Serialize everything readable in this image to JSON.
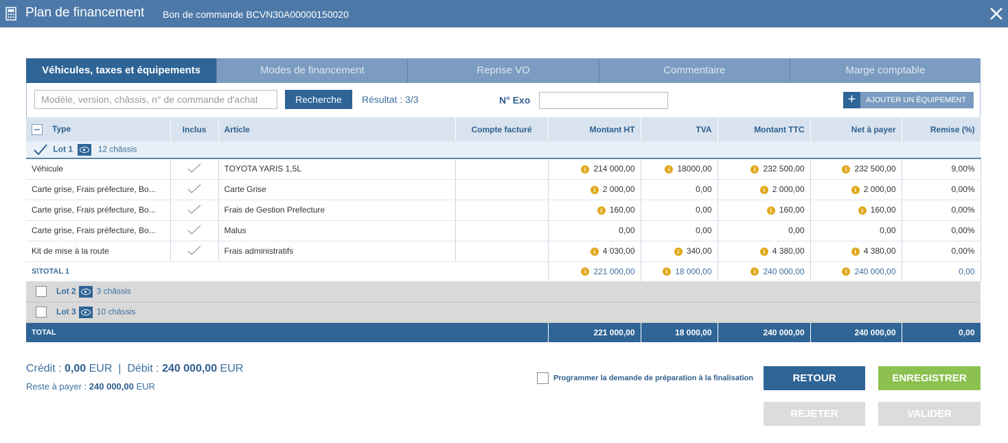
{
  "window": {
    "title": "Plan de financement",
    "subtitle": "Bon de commande BCVN30A00000150020"
  },
  "tabs": [
    {
      "label": "Véhicules, taxes et équipements",
      "active": true
    },
    {
      "label": "Modes de financement",
      "active": false
    },
    {
      "label": "Reprise VO",
      "active": false
    },
    {
      "label": "Commentaire",
      "active": false
    },
    {
      "label": "Marge comptable",
      "active": false
    }
  ],
  "toolbar": {
    "search_placeholder": "Modèle, version, châssis, n° de commande d'achat",
    "search_button": "Recherche",
    "result": "Résultat : 3/3",
    "exo_label": "N° Exo",
    "exo_value": "",
    "add_button": "AJOUTER UN ÉQUIPEMENT"
  },
  "columns": [
    "Type",
    "Inclus",
    "Article",
    "Compte facturé",
    "Montant HT",
    "TVA",
    "Montant TTC",
    "Net à payer",
    "Remise (%)"
  ],
  "lot1": {
    "label": "Lot 1",
    "chassis": "12 châssis"
  },
  "rows": [
    {
      "type": "Véhicule",
      "article": "TOYOTA YARIS 1,5L",
      "compte": "",
      "ht": "214 000,00",
      "tva": "18000,00",
      "ttc": "232 500,00",
      "net": "232 500,00",
      "remise": "9,00%"
    },
    {
      "type": "Carte grise, Frais préfecture, Bo...",
      "article": "Carte Grise",
      "compte": "",
      "ht": "2 000,00",
      "tva": "0,00",
      "ttc": "2 000,00",
      "net": "2 000,00",
      "remise": "0,00%"
    },
    {
      "type": "Carte grise, Frais préfecture, Bo...",
      "article": "Frais de Gestion Prefecture",
      "compte": "",
      "ht": "160,00",
      "tva": "0,00",
      "ttc": "160,00",
      "net": "160,00",
      "remise": "0,00%"
    },
    {
      "type": "Carte grise, Frais préfecture, Bo...",
      "article": "Malus",
      "compte": "",
      "ht": "0,00",
      "tva": "0,00",
      "ttc": "0,00",
      "net": "0,00",
      "remise": "0,00%"
    },
    {
      "type": "Kit de mise à la route",
      "article": "Frais administratifs",
      "compte": "",
      "ht": "4 030,00",
      "tva": "340,00",
      "ttc": "4 380,00",
      "net": "4 380,00",
      "remise": "0,00%"
    }
  ],
  "subtotal": {
    "label": "S\\TOTAL 1",
    "ht": "221 000,00",
    "tva": "18 000,00",
    "ttc": "240 000,00",
    "net": "240 000,00",
    "remise": "0,00"
  },
  "lot2": {
    "label": "Lot 2",
    "chassis": "3 châssis"
  },
  "lot3": {
    "label": "Lot 3",
    "chassis": "10 châssis"
  },
  "total": {
    "label": "TOTAL",
    "ht": "221 000,00",
    "tva": "18 000,00",
    "ttc": "240 000,00",
    "net": "240 000,00",
    "remise": "0,00"
  },
  "footer": {
    "credit_label": "Crédit : ",
    "credit_value": "0,00",
    "currency": "EUR",
    "separator": "|",
    "debit_label": "Débit : ",
    "debit_value": "240 000,00",
    "reste_label": "Reste à payer : ",
    "reste_value": "240 000,00",
    "programmer": "Programmer la demande de préparation à la finalisation"
  },
  "buttons": {
    "retour": "RETOUR",
    "enregistrer": "ENREGISTRER",
    "rejeter": "REJETER",
    "valider": "VALIDER"
  },
  "colors": {
    "primary": "#2e6496",
    "header": "#4d79a8",
    "tab_inactive": "#7b9cc0",
    "green": "#8cc152",
    "info": "#e0a81c",
    "disabled": "#dcdcdc"
  }
}
